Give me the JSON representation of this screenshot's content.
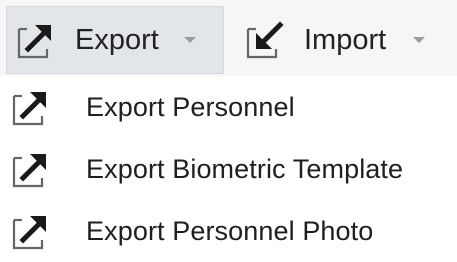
{
  "toolbar": {
    "export": {
      "label": "Export",
      "icon": "export-icon",
      "caret_icon": "caret-down-icon"
    },
    "import": {
      "label": "Import",
      "icon": "import-icon",
      "caret_icon": "caret-down-icon"
    }
  },
  "export_menu": {
    "items": [
      {
        "label": "Export Personnel",
        "icon": "export-icon"
      },
      {
        "label": "Export Biometric Template",
        "icon": "export-icon"
      },
      {
        "label": "Export Personnel Photo",
        "icon": "export-icon"
      }
    ]
  },
  "colors": {
    "toolbar_bg": "#f6f6f6",
    "active_button_bg": "#e2e6ea",
    "text": "#1f1f1f",
    "icon_arrow": "#1a1a1a",
    "icon_frame": "#666666",
    "caret": "#9a9a9a"
  }
}
